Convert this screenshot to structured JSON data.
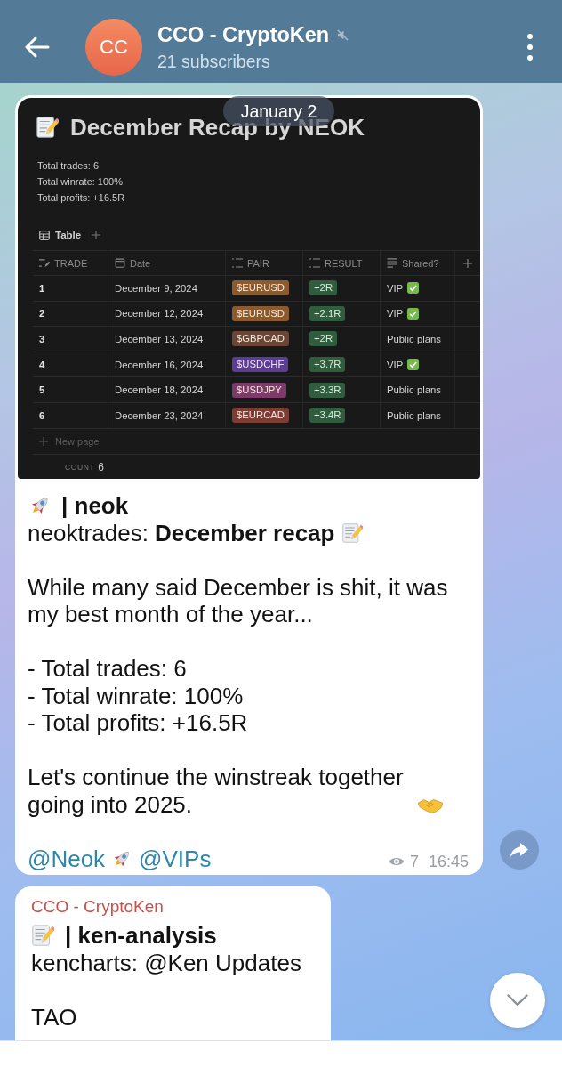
{
  "header": {
    "title": "CCO - CryptoKen",
    "muted": true,
    "subtitle": "21 subscribers",
    "avatar_initials": "CC"
  },
  "date_pill": "January 2",
  "messages": [
    {
      "image": {
        "title": "December Recap by NEOK",
        "stats": [
          "Total trades: 6",
          "Total winrate: 100%",
          "Total profits: +16.5R"
        ],
        "view_tab": "Table",
        "columns": [
          "TRADE",
          "Date",
          "PAIR",
          "RESULT",
          "Shared?"
        ],
        "rows": [
          {
            "trade": "1",
            "date": "December 9, 2024",
            "pair": {
              "text": "$EURUSD",
              "color": "#8b5a2d"
            },
            "result": "+2R",
            "shared": "VIP",
            "shared_check": true
          },
          {
            "trade": "2",
            "date": "December 12, 2024",
            "pair": {
              "text": "$EURUSD",
              "color": "#8b5a2d"
            },
            "result": "+2.1R",
            "shared": "VIP",
            "shared_check": true
          },
          {
            "trade": "3",
            "date": "December 13, 2024",
            "pair": {
              "text": "$GBPCAD",
              "color": "#6b4636"
            },
            "result": "+2R",
            "shared": "Public plans",
            "shared_check": false
          },
          {
            "trade": "4",
            "date": "December 16, 2024",
            "pair": {
              "text": "$USDCHF",
              "color": "#5b3d96"
            },
            "result": "+3.7R",
            "shared": "VIP",
            "shared_check": true
          },
          {
            "trade": "5",
            "date": "December 18, 2024",
            "pair": {
              "text": "$USDJPY",
              "color": "#7c3b68"
            },
            "result": "+3.3R",
            "shared": "Public plans",
            "shared_check": false
          },
          {
            "trade": "6",
            "date": "December 23, 2024",
            "pair": {
              "text": "$EURCAD",
              "color": "#7d3c34"
            },
            "result": "+3.4R",
            "shared": "Public plans",
            "shared_check": false
          }
        ],
        "new_row": "New page",
        "count_label": "COUNT",
        "count_value": "6"
      },
      "heading": "| neok",
      "caption": "neoktrades: **December recap**",
      "intro": "While many said December is shit, it was my best month of the year...",
      "stats": [
        "- Total trades: 6",
        "- Total winrate: 100%",
        "- Total profits: +16.5R"
      ],
      "outro": "Let's continue the winstreak together going into 2025.",
      "links": [
        "@Neok",
        "@VIPs"
      ],
      "views": "7",
      "time": "16:45"
    },
    {
      "sender": "CCO - CryptoKen",
      "heading": "| ken-analysis",
      "caption": "kencharts: @Ken Updates",
      "body": "TAO"
    }
  ]
}
